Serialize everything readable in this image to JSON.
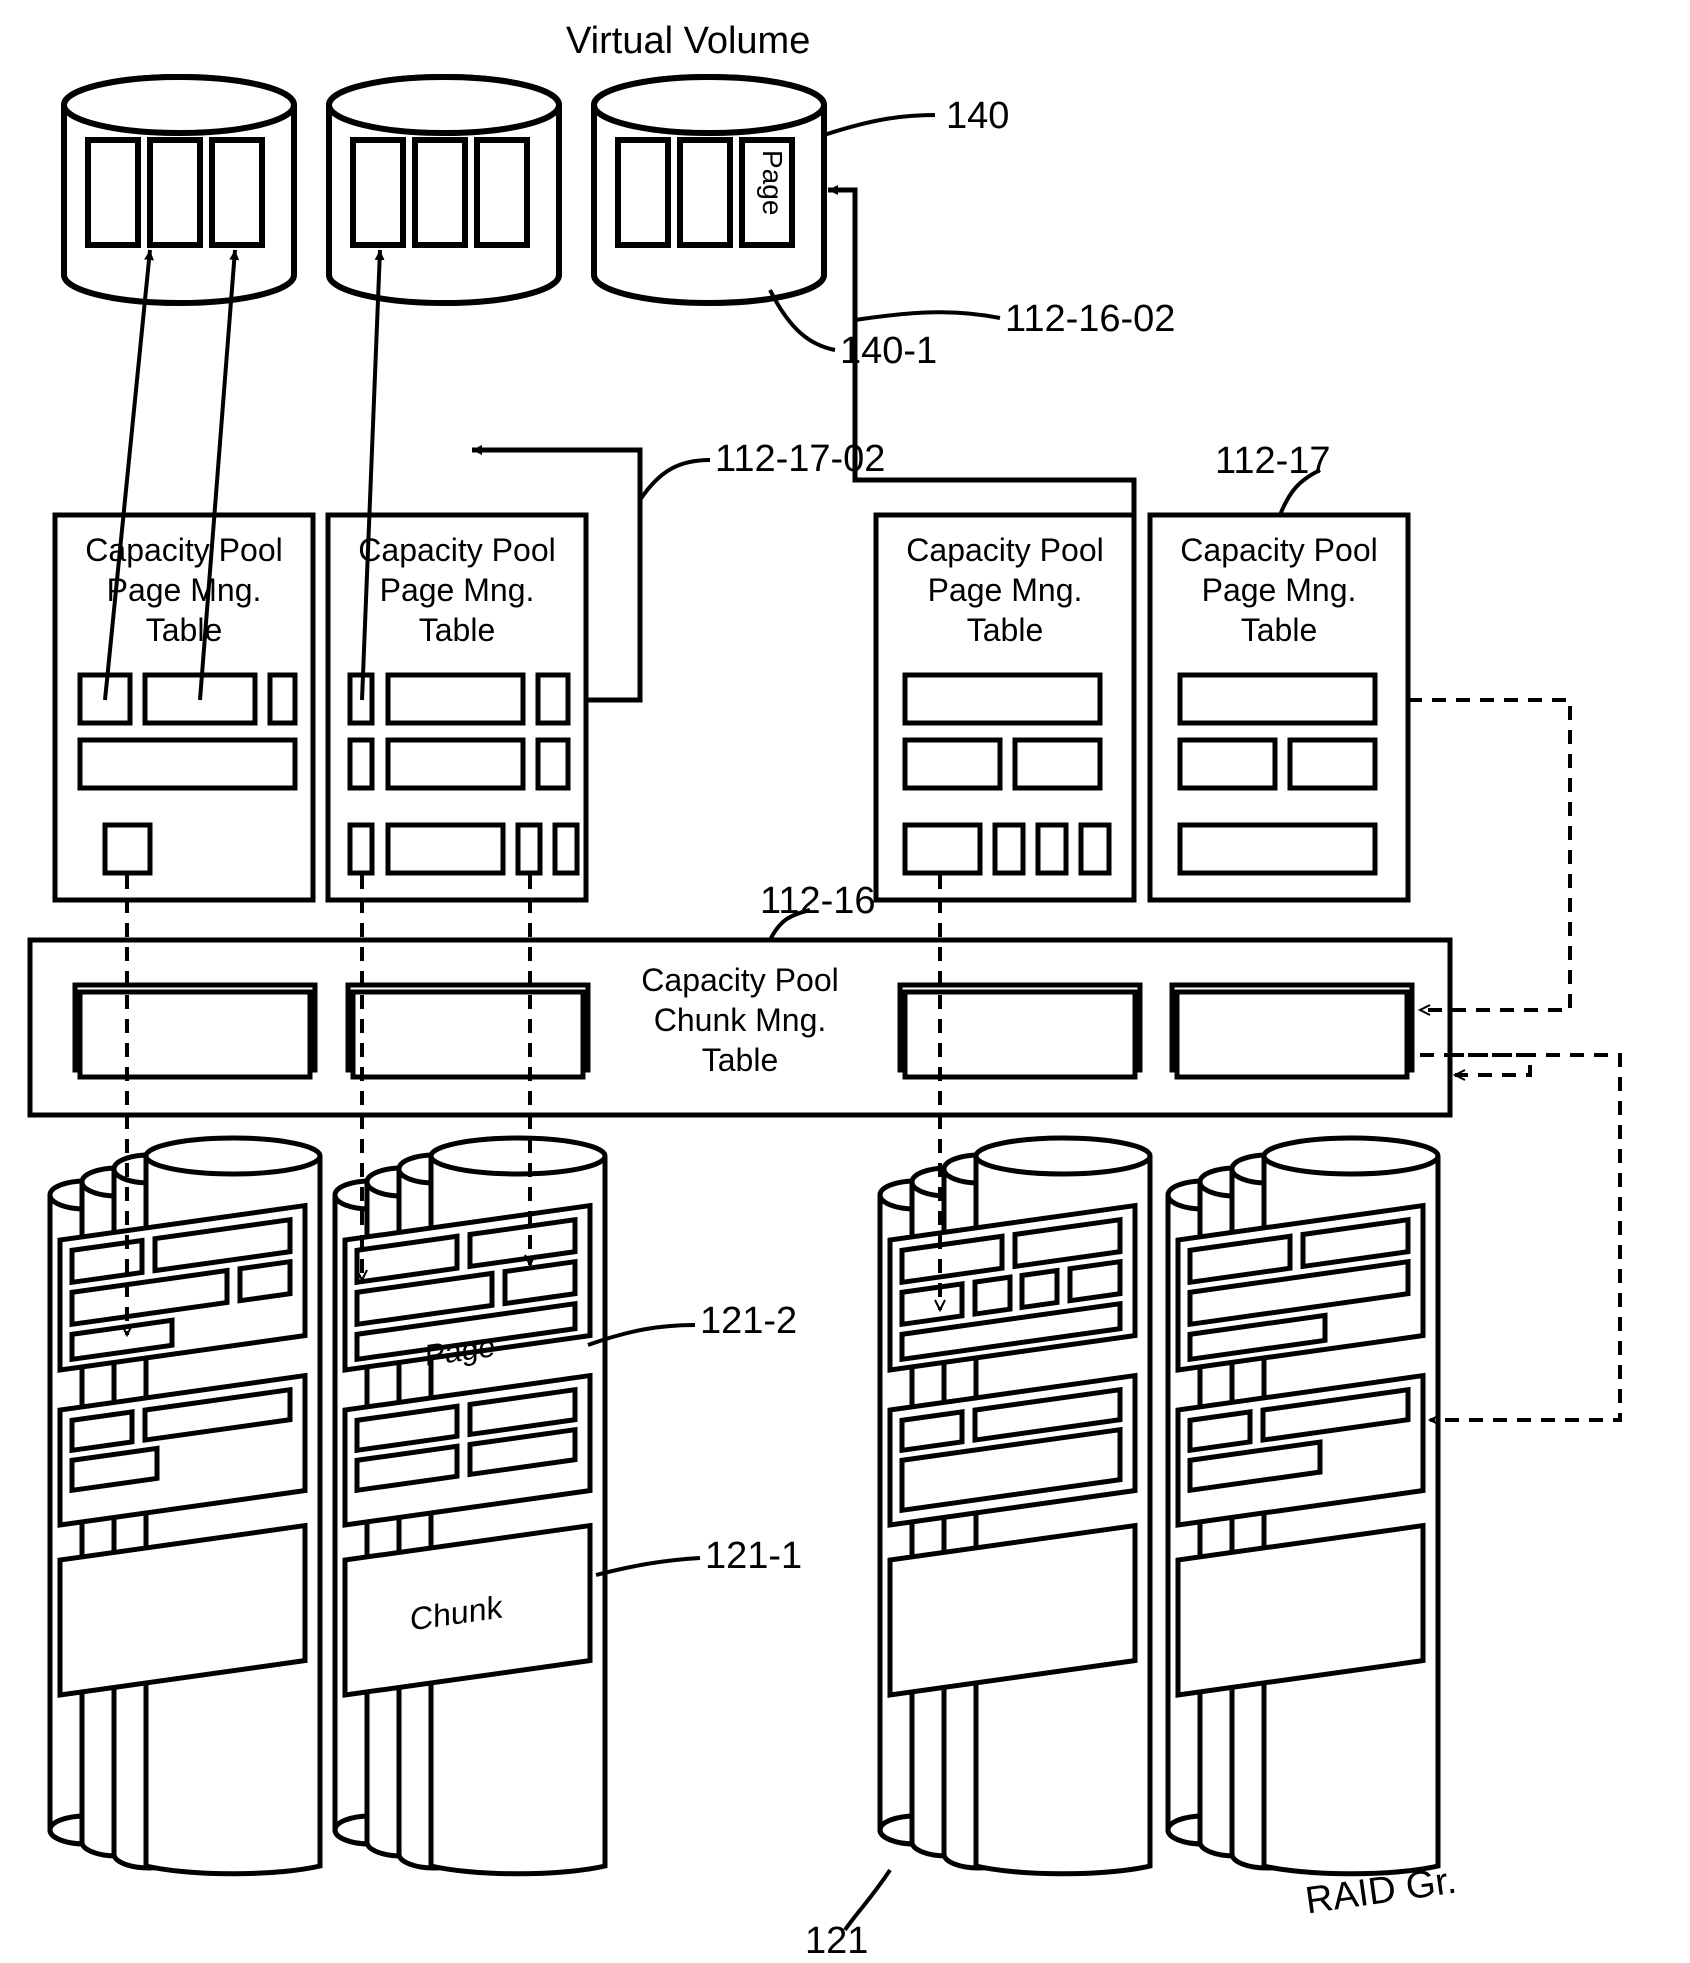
{
  "title": "Virtual Volume",
  "refs": {
    "vv_group": "140",
    "page_in_vv": "140-1",
    "page_table_arrow": "112-17-02",
    "chunk_table_arrow": "112-16-02",
    "page_table_right": "112-17",
    "chunk_table_id": "112-16",
    "raid_page": "121-2",
    "raid_chunk": "121-1",
    "raid_group": "121"
  },
  "page_table_label": "Capacity Pool\nPage Mng.\nTable",
  "chunk_table_label": "Capacity Pool\nChunk Mng.\nTable",
  "vv_page_label": "Page",
  "raid_page_label": "Page",
  "raid_chunk_label": "Chunk",
  "raid_gr_label": "RAID Gr."
}
